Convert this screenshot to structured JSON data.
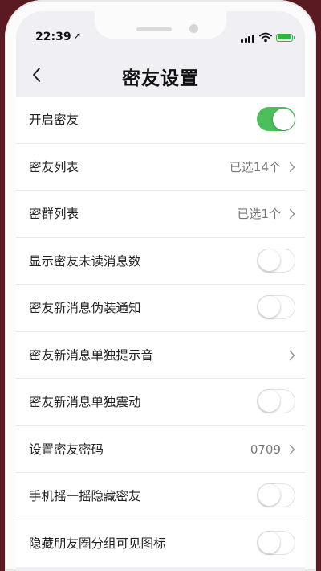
{
  "status_bar": {
    "time": "22:39",
    "location_icon": "location-arrow-icon",
    "signal_icon": "cellular-signal-icon",
    "wifi_icon": "wifi-icon",
    "battery_icon": "battery-charging-icon",
    "battery_color": "#2fb344"
  },
  "nav": {
    "back_icon": "chevron-left-icon",
    "title": "密友设置"
  },
  "colors": {
    "toggle_on": "#4cbf5b",
    "background": "#efeff4",
    "row_value": "#777777"
  },
  "settings": [
    {
      "label": "开启密友",
      "control": "toggle",
      "on": true
    },
    {
      "label": "密友列表",
      "control": "disclosure",
      "value": "已选14个"
    },
    {
      "label": "密群列表",
      "control": "disclosure",
      "value": "已选1个"
    },
    {
      "label": "显示密友未读消息数",
      "control": "toggle",
      "on": false
    },
    {
      "label": "密友新消息伪装通知",
      "control": "toggle",
      "on": false
    },
    {
      "label": "密友新消息单独提示音",
      "control": "disclosure",
      "value": ""
    },
    {
      "label": "密友新消息单独震动",
      "control": "toggle",
      "on": false
    },
    {
      "label": "设置密友密码",
      "control": "disclosure",
      "value": "0709"
    },
    {
      "label": "手机摇一摇隐藏密友",
      "control": "toggle",
      "on": false
    },
    {
      "label": "隐藏朋友圈分组可见图标",
      "control": "toggle",
      "on": false
    }
  ]
}
